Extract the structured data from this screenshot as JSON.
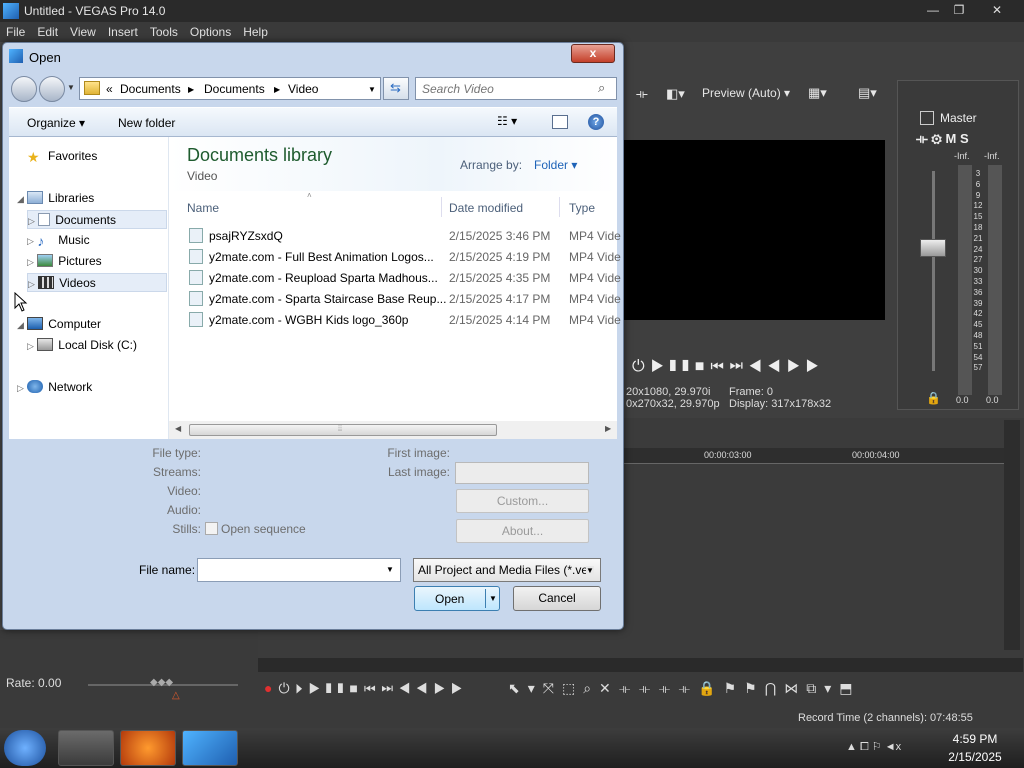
{
  "vegas": {
    "title": "Untitled - VEGAS Pro 14.0",
    "menu": [
      "File",
      "Edit",
      "View",
      "Insert",
      "Tools",
      "Options",
      "Help"
    ],
    "preview_mode": "Preview (Auto)",
    "master_label": "Master",
    "inf_left": "-Inf.",
    "inf_right": "-Inf.",
    "meter_ticks": [
      "3",
      "6",
      "9",
      "12",
      "15",
      "18",
      "21",
      "24",
      "27",
      "30",
      "33",
      "36",
      "39",
      "42",
      "45",
      "48",
      "51",
      "54",
      "57"
    ],
    "meter_val_left": "0.0",
    "meter_val_right": "0.0",
    "project_info_1": "20x1080, 29.970i",
    "project_info_2": "0x270x32, 29.970p",
    "frame_label": "Frame:",
    "frame_value": "0",
    "display_label": "Display:",
    "display_value": "317x178x32",
    "timecode_1": "00:00:03:00",
    "timecode_2": "00:00:04:00",
    "rate": "Rate: 0.00",
    "record_time": "Record Time (2 channels): 07:48:55"
  },
  "dialog": {
    "title": "Open",
    "close_label": "x",
    "breadcrumb": [
      "Documents",
      "Documents",
      "Video"
    ],
    "breadcrumb_prefix": "«",
    "search_placeholder": "Search Video",
    "organize_label": "Organize",
    "new_folder_label": "New folder",
    "library_title": "Documents library",
    "library_subtitle": "Video",
    "arrange_by_label": "Arrange by:",
    "arrange_by_value": "Folder",
    "columns": {
      "name": "Name",
      "date": "Date modified",
      "type": "Type"
    },
    "files": [
      {
        "name": "psajRYZsxdQ",
        "date": "2/15/2025 3:46 PM",
        "type": "MP4 Vide"
      },
      {
        "name": "y2mate.com - Full Best Animation Logos...",
        "date": "2/15/2025 4:19 PM",
        "type": "MP4 Vide"
      },
      {
        "name": "y2mate.com - Reupload Sparta Madhous...",
        "date": "2/15/2025 4:35 PM",
        "type": "MP4 Vide"
      },
      {
        "name": "y2mate.com - Sparta Staircase Base Reup...",
        "date": "2/15/2025 4:17 PM",
        "type": "MP4 Vide"
      },
      {
        "name": "y2mate.com - WGBH Kids logo_360p",
        "date": "2/15/2025 4:14 PM",
        "type": "MP4 Vide"
      }
    ],
    "nav": {
      "favorites": "Favorites",
      "libraries": "Libraries",
      "documents": "Documents",
      "music": "Music",
      "pictures": "Pictures",
      "videos": "Videos",
      "computer": "Computer",
      "local_disk": "Local Disk (C:)",
      "network": "Network"
    },
    "details": {
      "file_type": "File type:",
      "streams": "Streams:",
      "video": "Video:",
      "audio": "Audio:",
      "stills": "Stills:",
      "open_sequence": "Open sequence",
      "first_image": "First image:",
      "last_image": "Last image:",
      "custom": "Custom...",
      "about": "About..."
    },
    "file_name_label": "File name:",
    "file_name_value": "",
    "file_type_filter": "All Project and Media Files (*.ve",
    "open_label": "Open",
    "cancel_label": "Cancel"
  },
  "taskbar": {
    "time": "4:59 PM",
    "date": "2/15/2025"
  }
}
